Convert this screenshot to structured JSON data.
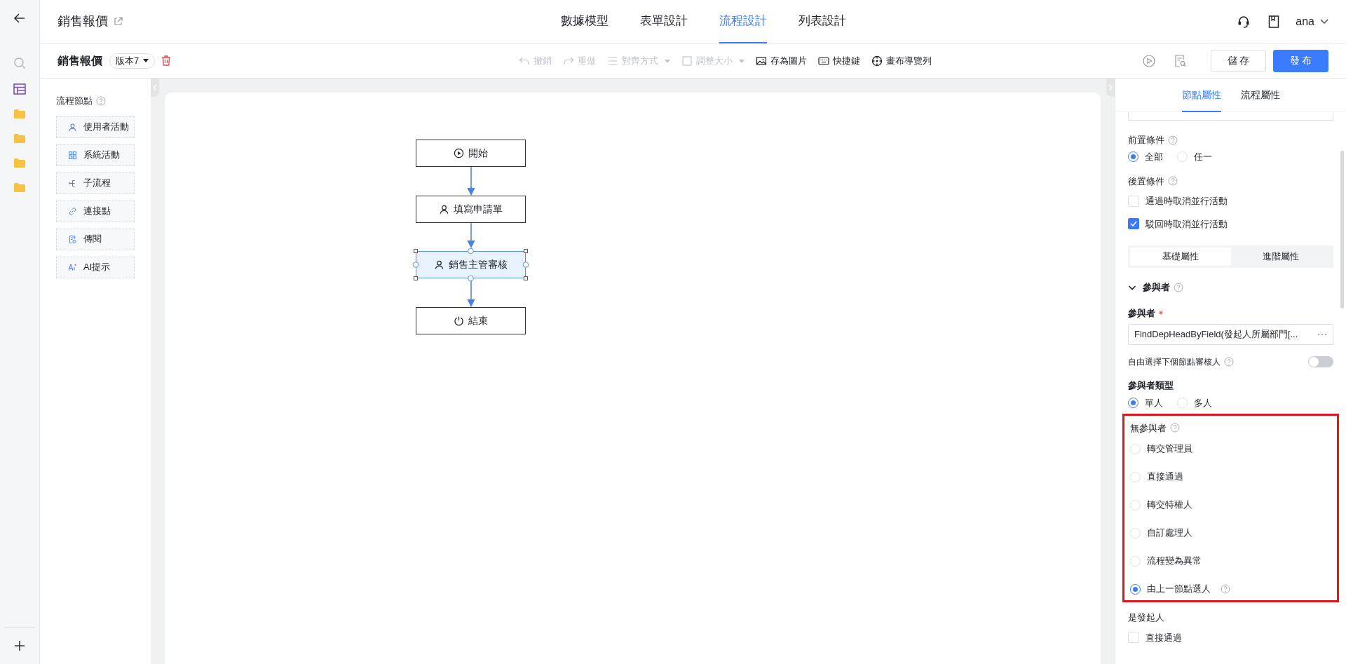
{
  "header": {
    "title": "銷售報價",
    "tabs": [
      {
        "label": "數據模型",
        "selected": false
      },
      {
        "label": "表單設計",
        "selected": false
      },
      {
        "label": "流程設計",
        "selected": true
      },
      {
        "label": "列表設計",
        "selected": false
      }
    ],
    "user": "ana"
  },
  "toolbar": {
    "process_name": "銷售報價",
    "version": "版本7",
    "actions": [
      {
        "label": "撤銷",
        "kind": "undo",
        "disabled": true,
        "dropdown": false
      },
      {
        "label": "重做",
        "kind": "redo",
        "disabled": true,
        "dropdown": false
      },
      {
        "label": "對齊方式",
        "kind": "align",
        "disabled": true,
        "dropdown": true
      },
      {
        "label": "調整大小",
        "kind": "resize",
        "disabled": true,
        "dropdown": true
      },
      {
        "label": "存為圖片",
        "kind": "image",
        "disabled": false,
        "dropdown": false
      },
      {
        "label": "快捷鍵",
        "kind": "keyboard",
        "disabled": false,
        "dropdown": false
      },
      {
        "label": "畫布導覽列",
        "kind": "navigator",
        "disabled": false,
        "dropdown": false
      }
    ],
    "buttons": [
      {
        "label": "儲 存",
        "kind": "default"
      },
      {
        "label": "發 布",
        "kind": "primary"
      }
    ]
  },
  "node_palette": {
    "title": "流程節點",
    "items": [
      {
        "label": "使用者活動",
        "kind": "user"
      },
      {
        "label": "系統活動",
        "kind": "system"
      },
      {
        "label": "子流程",
        "kind": "subflow"
      },
      {
        "label": "連接點",
        "kind": "link"
      },
      {
        "label": "傳閱",
        "kind": "circulate"
      },
      {
        "label": "AI提示",
        "kind": "ai"
      }
    ]
  },
  "flow": {
    "nodes": [
      {
        "label": "開始",
        "kind": "start",
        "selected": false
      },
      {
        "label": "填寫申請單",
        "kind": "user",
        "selected": false
      },
      {
        "label": "銷售主管審核",
        "kind": "user",
        "selected": true
      },
      {
        "label": "結束",
        "kind": "end",
        "selected": false
      }
    ]
  },
  "properties": {
    "tabs": [
      {
        "label": "節點屬性",
        "selected": true
      },
      {
        "label": "流程屬性",
        "selected": false
      }
    ],
    "pre_condition": {
      "label": "前置條件",
      "options": [
        {
          "label": "全部",
          "selected": true
        },
        {
          "label": "任一",
          "selected": false
        }
      ]
    },
    "post_condition": {
      "label": "後置條件",
      "options": [
        {
          "label": "通過時取消並行活動",
          "checked": false
        },
        {
          "label": "駁回時取消並行活動",
          "checked": true
        }
      ]
    },
    "segments": [
      {
        "label": "基礎屬性",
        "selected": true
      },
      {
        "label": "進階屬性",
        "selected": false
      }
    ],
    "section": {
      "label": "參與者",
      "expanded": true
    },
    "participant": {
      "label": "參與者",
      "required": true,
      "value": "FindDepHeadByField(發起人所屬部門[..."
    },
    "free_select": {
      "label": "自由選擇下個節點審核人",
      "on": false
    },
    "participant_type": {
      "label": "參與者類型",
      "options": [
        {
          "label": "單人",
          "selected": true
        },
        {
          "label": "多人",
          "selected": false
        }
      ]
    },
    "no_participant": {
      "label": "無參與者",
      "options": [
        {
          "label": "轉交管理員",
          "selected": false,
          "help": false
        },
        {
          "label": "直接通過",
          "selected": false,
          "help": false
        },
        {
          "label": "轉交特權人",
          "selected": false,
          "help": false
        },
        {
          "label": "自訂處理人",
          "selected": false,
          "help": false
        },
        {
          "label": "流程變為異常",
          "selected": false,
          "help": false
        },
        {
          "label": "由上一節點選人",
          "selected": true,
          "help": true
        }
      ]
    },
    "initiator": {
      "label": "是發起人",
      "options": [
        {
          "label": "直接通過",
          "checked": false
        }
      ]
    }
  }
}
